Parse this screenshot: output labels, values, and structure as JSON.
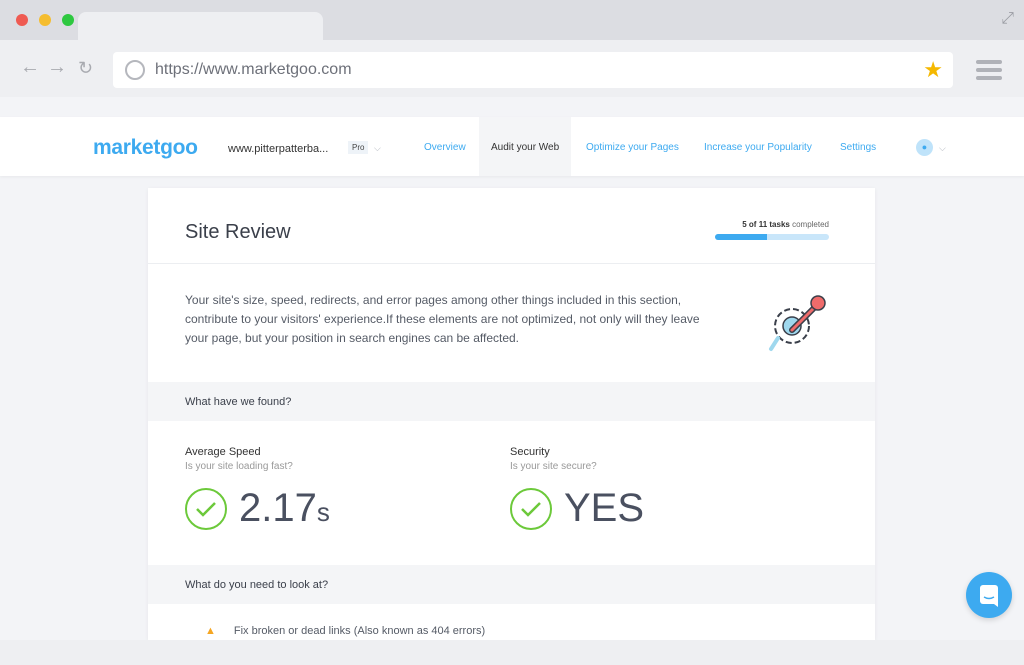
{
  "browser": {
    "url": "https://www.marketgoo.com"
  },
  "nav": {
    "logo": "marketgoo",
    "site": "www.pitterpatterba...",
    "plan": "Pro",
    "items": [
      {
        "label": "Overview"
      },
      {
        "label": "Audit your Web"
      },
      {
        "label": "Optimize your Pages"
      },
      {
        "label": "Increase your Popularity"
      },
      {
        "label": "Settings"
      }
    ]
  },
  "card": {
    "title": "Site Review",
    "tasks_done": "5 of 11 tasks",
    "tasks_suffix": "completed",
    "progress": 0.4545,
    "description": "Your site's size, speed, redirects, and error pages among other things included in this section, contribute to your visitors' experience.If these elements are not optimized, not only will they leave your page, but your position in search engines can be affected.",
    "found_header": "What have we found?",
    "metrics": [
      {
        "label": "Average Speed",
        "sub": "Is your site loading fast?",
        "value": "2.17",
        "unit": "s"
      },
      {
        "label": "Security",
        "sub": "Is your site secure?",
        "value": "YES",
        "unit": ""
      }
    ],
    "look_header": "What do you need to look at?",
    "items": [
      {
        "label": "Fix broken or dead links (Also known as 404 errors)"
      }
    ]
  },
  "colors": {
    "accent": "#3daaf0",
    "success": "#6cc93a",
    "warning": "#f5a623"
  }
}
